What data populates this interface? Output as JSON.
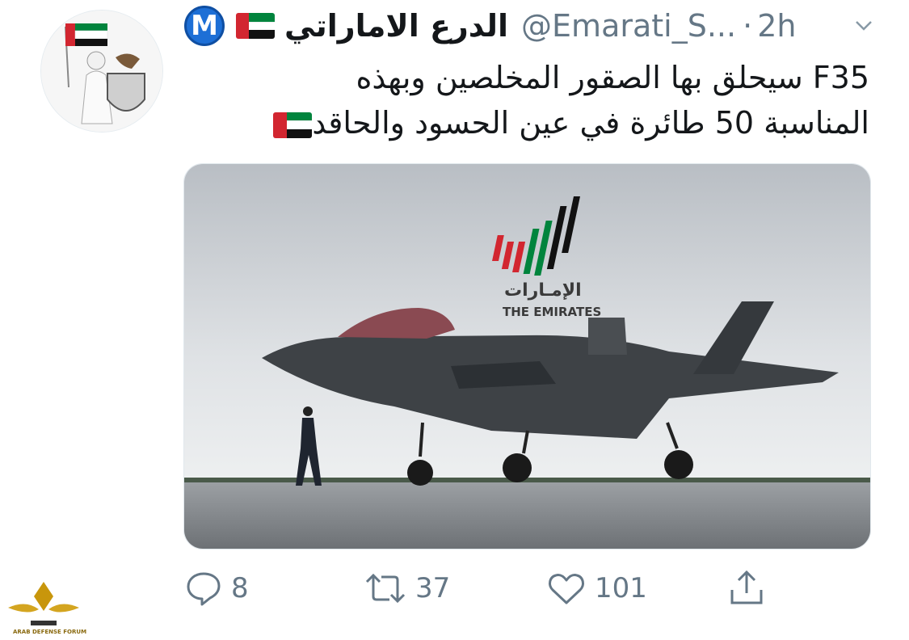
{
  "tweet": {
    "verified_initial": "M",
    "display_name": "الدرع الاماراتي",
    "handle": "@Emarati_S...",
    "separator": "·",
    "time": "2h",
    "text_line1": "F35 سيحلق بها الصقور المخلصين وبهذه",
    "text_line2": "المناسبة 50 طائرة في عين الحسود والحاقد",
    "avatar_label": "الدرع الاماراتي",
    "media": {
      "logo_ar": "الإمـارات",
      "logo_en": "THE EMIRATES"
    }
  },
  "actions": {
    "reply_count": "8",
    "retweet_count": "37",
    "like_count": "101"
  },
  "watermark": {
    "label": "ARAB DEFENSE FORUM"
  },
  "icons": [
    "m-badge",
    "uae-flag-icon",
    "chevron-down-icon",
    "reply-icon",
    "retweet-icon",
    "like-icon",
    "share-icon"
  ],
  "colors": {
    "flag_red": "#d22630",
    "flag_green": "#00843d",
    "action_gray": "#657786",
    "badge_blue": "#1d6fd6"
  }
}
